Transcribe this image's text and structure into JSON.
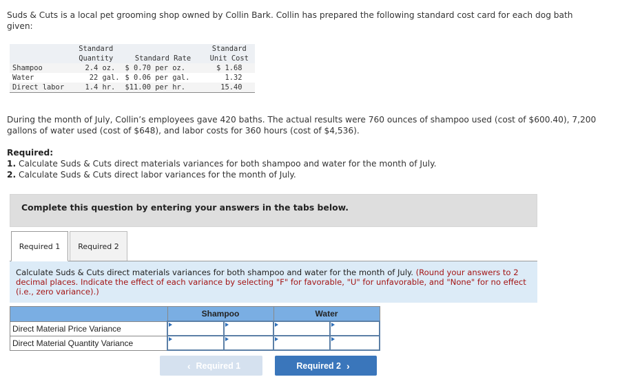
{
  "intro": "Suds & Cuts is a local pet grooming shop owned by Collin Bark. Collin has prepared the following standard cost card for each dog bath given:",
  "cost_card": {
    "headers": {
      "item": "",
      "qty_line1": "Standard",
      "qty_line2": "Quantity",
      "rate": "Standard Rate",
      "cost_line1": "Standard",
      "cost_line2": "Unit Cost"
    },
    "rows": [
      {
        "item": "Shampoo",
        "qty": "2.4 oz. ",
        "rate": "$ 0.70 per oz.",
        "cost": "$ 1.68"
      },
      {
        "item": "Water",
        "qty": "22 gal.",
        "rate": "$ 0.06 per gal.",
        "cost": "  1.32"
      },
      {
        "item": "Direct labor",
        "qty": "1.4 hr. ",
        "rate": "$11.00 per hr.",
        "cost": " 15.40"
      }
    ]
  },
  "actual_results": "During the month of July, Collin’s employees gave 420 baths. The actual results were 760 ounces of shampoo used (cost of $600.40), 7,200 gallons of water used (cost of $648), and labor costs for 360 hours (cost of $4,536).",
  "required": {
    "heading": "Required:",
    "items": [
      {
        "num": "1.",
        "text": " Calculate Suds & Cuts direct materials variances for both shampoo and water for the month of July."
      },
      {
        "num": "2.",
        "text": " Calculate Suds & Cuts direct labor variances for the month of July."
      }
    ]
  },
  "banner": "Complete this question by entering your answers in the tabs below.",
  "tabs": [
    {
      "label": "Required 1",
      "active": true
    },
    {
      "label": "Required 2",
      "active": false
    }
  ],
  "instruction": {
    "main": "Calculate Suds & Cuts direct materials variances for both shampoo and water for the month of July. ",
    "note": "(Round your answers to 2 decimal places. Indicate the effect of each variance by selecting \"F\" for favorable, \"U\" for unfavorable, and \"None\" for no effect (i.e., zero variance).)"
  },
  "answer_table": {
    "columns": [
      "Shampoo",
      "Water"
    ],
    "rows": [
      {
        "label": "Direct Material Price Variance",
        "shampoo_amount": "",
        "shampoo_effect": "",
        "water_amount": "",
        "water_effect": ""
      },
      {
        "label": "Direct Material Quantity Variance",
        "shampoo_amount": "",
        "shampoo_effect": "",
        "water_amount": "",
        "water_effect": ""
      }
    ]
  },
  "nav": {
    "prev_label": "Required 1",
    "prev_icon": "chevron-left-icon",
    "next_label": "Required 2",
    "next_icon": "chevron-right-icon"
  }
}
